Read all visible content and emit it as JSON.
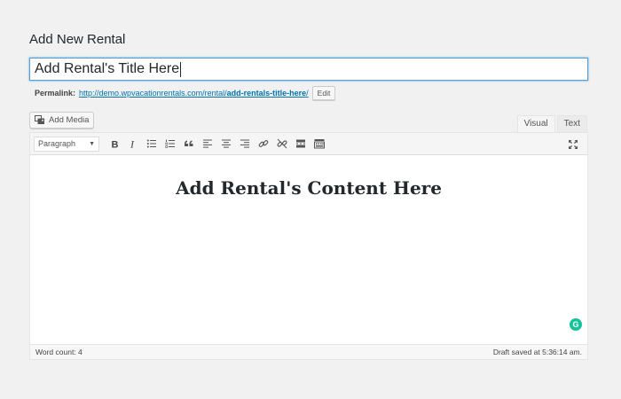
{
  "page": {
    "heading": "Add New Rental"
  },
  "title_field": {
    "value": "Add Rental's Title Here"
  },
  "permalink": {
    "label": "Permalink:",
    "url_base": "http://demo.wpvacationrentals.com/rental/",
    "slug": "add-rentals-title-here",
    "trailing": "/",
    "edit_label": "Edit"
  },
  "media": {
    "add_media_label": "Add Media",
    "icon": "media-icon"
  },
  "editor_tabs": [
    {
      "label": "Visual",
      "active": true
    },
    {
      "label": "Text",
      "active": false
    }
  ],
  "toolbar": {
    "format_value": "Paragraph",
    "buttons": [
      "bold",
      "italic",
      "bullet-list",
      "numbered-list",
      "blockquote",
      "align-left",
      "align-center",
      "align-right",
      "insert-link",
      "remove-link",
      "read-more",
      "toolbar-toggle"
    ]
  },
  "editor": {
    "content_heading": "Add Rental's Content Here",
    "grammarly_label": "G"
  },
  "status": {
    "word_count": "Word count: 4",
    "draft_saved": "Draft saved at 5:36:14 am."
  },
  "colors": {
    "link": "#0073aa",
    "focus_border": "#5b9dd9",
    "grammarly": "#15c39a",
    "background": "#f1f1f1"
  }
}
